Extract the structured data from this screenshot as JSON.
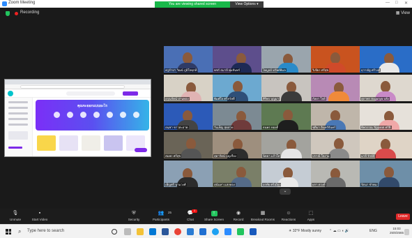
{
  "window": {
    "title": "Zoom Meeting",
    "controls": [
      "—",
      "□",
      "✕"
    ]
  },
  "share_banner": {
    "text": "You are viewing shared screen",
    "options_label": "View Options ▾"
  },
  "recording": {
    "label": "Recording"
  },
  "view_label": "View",
  "shared_screen": {
    "hero_title": "คุณจะออกแบบอะไร"
  },
  "participants": [
    "ครูจำปา วัฒน์ ภูมิใจทุกที่",
    "พชร์ ธมาลี พุ่มจันทร์",
    "ไพบูลย์ ทรัพย์พิมล",
    "วิเชียร ศรีสุข",
    "ยุวาณัฐ ศรีวงศ์",
    "อรุณรัตน์ ปานทอง",
    "พิมพ์ใจ ศรีสวัสดิ์",
    "ศิริพร บุญมา",
    "กัลยา ใจดี",
    "สุภาพร Sugunya ปลั่ง",
    "อนุชา ขาวสะอาด",
    "วันเพ็ญ สุดสวย",
    "ธนพร ทองดี",
    "ชุติมา อินทร์จันทร์",
    "ทิพวรรณ Tipparat ศรีดิ",
    "สมพร ศรีสุข",
    "สุดารัตน์ บุญเรือง",
    "นิตยา แก้วใส",
    "ปราณี ใจงาม",
    "มาลี รักษ์ดี",
    "เพ็ญศรี นามวงศ์",
    "สุนันทา แสงทอง",
    "อรทัย ศรีเมือง",
    "ผกา ดวงดี",
    "รัตนา ขำคม"
  ],
  "toolbar": {
    "unmute": "Unmute",
    "start_video": "Start Video",
    "security": "Security",
    "participants": "Participants",
    "participants_count": "25",
    "chat": "Chat",
    "chat_badge": "1",
    "share_screen": "Share Screen",
    "record": "Record",
    "breakout_rooms": "Breakout Rooms",
    "reactions": "Reactions",
    "apps": "Apps",
    "leave": "Leave"
  },
  "taskbar": {
    "search_placeholder": "Type here to search",
    "weather": "32°F Mostly sunny",
    "language": "ENG",
    "time": "15:03",
    "date": "25/8/2565"
  },
  "colors": {
    "accent": "#2d8cff",
    "share_green": "#19b84a",
    "leave_red": "#e02828",
    "canva_purple": "#7d2ae8",
    "active_speaker": "#f5d01b"
  }
}
